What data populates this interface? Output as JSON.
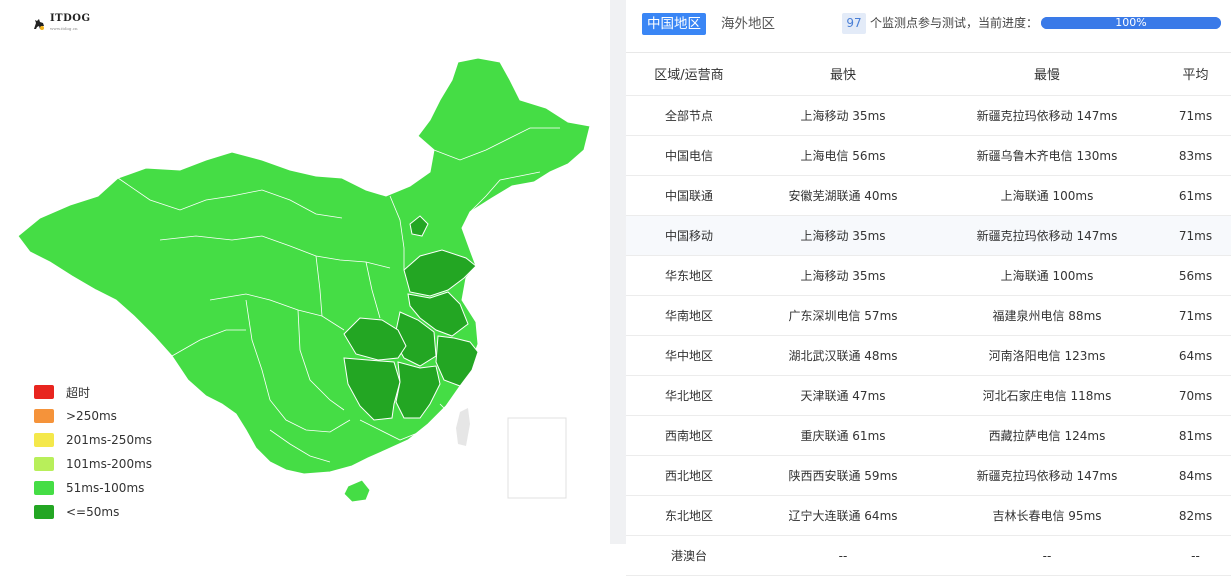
{
  "logo": {
    "text": "ITDOG",
    "subtext": "www.itdog.cn"
  },
  "colors": {
    "accent": "#3a86f5",
    "timeout": "#e8251f",
    "over250": "#f5933a",
    "r201_250": "#f4e84b",
    "r101_200": "#b8ef5a",
    "r51_100": "#45dd45",
    "le50": "#23a623"
  },
  "legend": [
    {
      "label": "超时",
      "color": "#e8251f"
    },
    {
      "label": ">250ms",
      "color": "#f5933a"
    },
    {
      "label": "201ms-250ms",
      "color": "#f4e84b"
    },
    {
      "label": "101ms-200ms",
      "color": "#b8ef5a"
    },
    {
      "label": "51ms-100ms",
      "color": "#45dd45"
    },
    {
      "label": "<=50ms",
      "color": "#23a623"
    }
  ],
  "tabs": {
    "china": "中国地区",
    "overseas": "海外地区"
  },
  "status": {
    "count": "97",
    "text": "个监测点参与测试，当前进度：",
    "progress": "100%",
    "progress_value": 100
  },
  "table": {
    "headers": [
      "区域/运营商",
      "最快",
      "最慢",
      "平均"
    ],
    "rows": [
      {
        "region": "全部节点",
        "fastest": "上海移动 35ms",
        "slowest": "新疆克拉玛依移动 147ms",
        "avg": "71ms"
      },
      {
        "region": "中国电信",
        "fastest": "上海电信 56ms",
        "slowest": "新疆乌鲁木齐电信 130ms",
        "avg": "83ms"
      },
      {
        "region": "中国联通",
        "fastest": "安徽芜湖联通 40ms",
        "slowest": "上海联通 100ms",
        "avg": "61ms"
      },
      {
        "region": "中国移动",
        "fastest": "上海移动 35ms",
        "slowest": "新疆克拉玛依移动 147ms",
        "avg": "71ms"
      },
      {
        "region": "华东地区",
        "fastest": "上海移动 35ms",
        "slowest": "上海联通 100ms",
        "avg": "56ms"
      },
      {
        "region": "华南地区",
        "fastest": "广东深圳电信 57ms",
        "slowest": "福建泉州电信 88ms",
        "avg": "71ms"
      },
      {
        "region": "华中地区",
        "fastest": "湖北武汉联通 48ms",
        "slowest": "河南洛阳电信 123ms",
        "avg": "64ms"
      },
      {
        "region": "华北地区",
        "fastest": "天津联通 47ms",
        "slowest": "河北石家庄电信 118ms",
        "avg": "70ms"
      },
      {
        "region": "西南地区",
        "fastest": "重庆联通 61ms",
        "slowest": "西藏拉萨电信 124ms",
        "avg": "81ms"
      },
      {
        "region": "西北地区",
        "fastest": "陕西西安联通 59ms",
        "slowest": "新疆克拉玛依移动 147ms",
        "avg": "84ms"
      },
      {
        "region": "东北地区",
        "fastest": "辽宁大连联通 64ms",
        "slowest": "吉林长春电信 95ms",
        "avg": "82ms"
      },
      {
        "region": "港澳台",
        "fastest": "--",
        "slowest": "--",
        "avg": "--"
      }
    ]
  }
}
